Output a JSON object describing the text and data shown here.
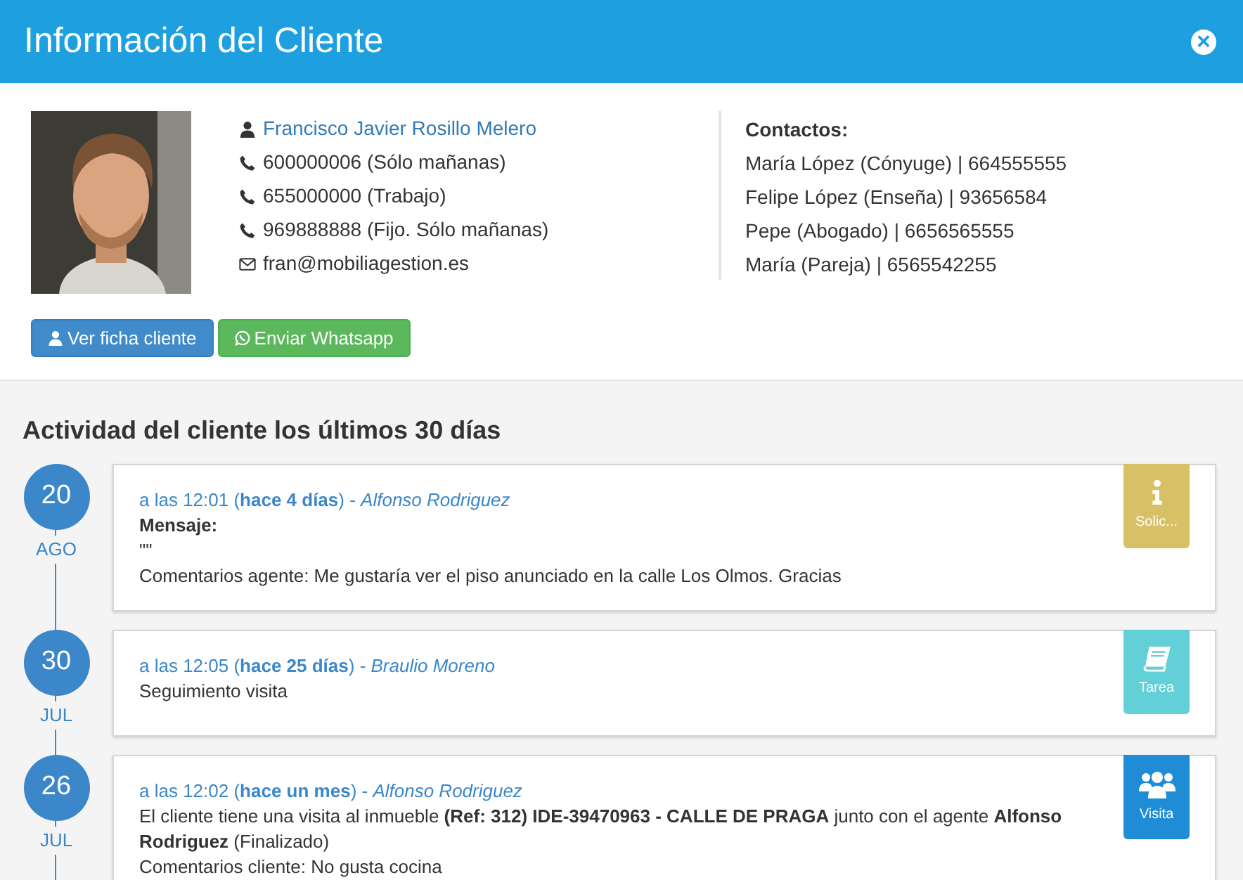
{
  "modal": {
    "title": "Información del Cliente",
    "close": "×"
  },
  "client": {
    "photo": {
      "kind": "picture"
    },
    "details": [
      {
        "kind": "user",
        "text": "Francisco Javier Rosillo Melero"
      },
      {
        "kind": "phone",
        "text": "600000006 (Sólo mañanas)"
      },
      {
        "kind": "phone",
        "text": "655000000 (Trabajo)"
      },
      {
        "kind": "phone",
        "text": "969888888 (Fijo. Sólo mañanas)"
      },
      {
        "kind": "mail",
        "text": "fran@mobiliagestion.es"
      }
    ],
    "contacts_title": "Contactos:",
    "contacts": [
      "María López (Cónyuge) | 664555555",
      "Felipe López (Enseña) | 93656584",
      "Pepe (Abogado) | 6656565555",
      "María (Pareja) | 6565542255"
    ],
    "buttons": [
      {
        "kind": "profile",
        "label": "Ver ficha cliente"
      },
      {
        "kind": "whatsapp",
        "label": "Enviar Whatsapp"
      }
    ]
  },
  "activity": {
    "title": "Actividad del cliente los últimos 30 días",
    "entries": [
      {
        "day": "20",
        "month": "AGO",
        "kind": "info",
        "badge": "Solic...",
        "header": "a las 12:01 (**hace 4 días**) - *Alfonso Rodriguez*",
        "lines": [
          "**Mensaje:**",
          "\"\"",
          "Comentarios agente: Me gustaría ver el piso anunciado en la calle Los Olmos. Gracias"
        ]
      },
      {
        "day": "30",
        "month": "JUL",
        "kind": "task",
        "badge": "Tarea",
        "header": "a las 12:05 (**hace 25 días**) - *Braulio Moreno*",
        "lines": [
          "Seguimiento visita"
        ]
      },
      {
        "day": "26",
        "month": "JUL",
        "kind": "visit",
        "badge": "Visita",
        "header": "a las 12:02 (**hace un mes**) - *Alfonso Rodriguez*",
        "lines": [
          "El cliente tiene una visita al inmueble **(Ref: 312) IDE-39470963 - CALLE DE PRAGA** junto con el agente **Alfonso Rodriguez** (Finalizado)",
          "Comentarios cliente: No gusta cocina"
        ]
      }
    ]
  }
}
